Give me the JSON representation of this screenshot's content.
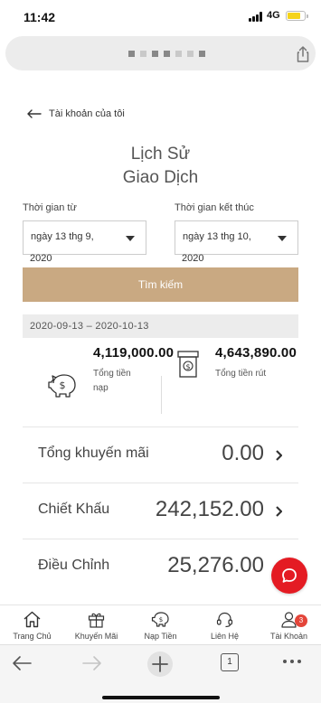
{
  "status_bar": {
    "time": "11:42",
    "network": "4G",
    "battery_level": 0.8,
    "battery_color": "#f5d31a"
  },
  "browser": {
    "share_icon": "share-icon",
    "tab_count": "1"
  },
  "header": {
    "back_label": "Tài khoản của tôi",
    "title_line1": "Lịch Sử",
    "title_line2": "Giao Dịch"
  },
  "filters": {
    "from_label": "Thời gian từ",
    "to_label": "Thời gian kết thúc",
    "from_date": "ngày 13 thg 9,",
    "from_year": "2020",
    "to_date": "ngày 13 thg 10,",
    "to_year": "2020",
    "search_label": "Tìm kiếm",
    "search_color": "#c9a982",
    "range_text": "2020-09-13 – 2020-10-13"
  },
  "summary": {
    "deposit_amount": "4,119,000.00",
    "deposit_label": "Tổng tiền nạp",
    "withdraw_amount": "4,643,890.00",
    "withdraw_label": "Tổng tiền rút"
  },
  "rows": [
    {
      "label": "Tổng khuyến mãi",
      "value": "0.00"
    },
    {
      "label": "Chiết Khấu",
      "value": "242,152.00"
    },
    {
      "label": "Điều Chỉnh",
      "value": "25,276.00"
    }
  ],
  "chat": {
    "icon": "chat-icon",
    "color": "#e41b23"
  },
  "tabbar": {
    "items": [
      {
        "label": "Trang Chủ",
        "icon": "home-icon"
      },
      {
        "label": "Khuyến Mãi",
        "icon": "gift-icon"
      },
      {
        "label": "Nạp Tiền",
        "icon": "piggy-bank-icon"
      },
      {
        "label": "Liên Hệ",
        "icon": "headset-icon"
      },
      {
        "label": "Tài Khoản",
        "icon": "user-icon",
        "badge": "3"
      }
    ]
  }
}
